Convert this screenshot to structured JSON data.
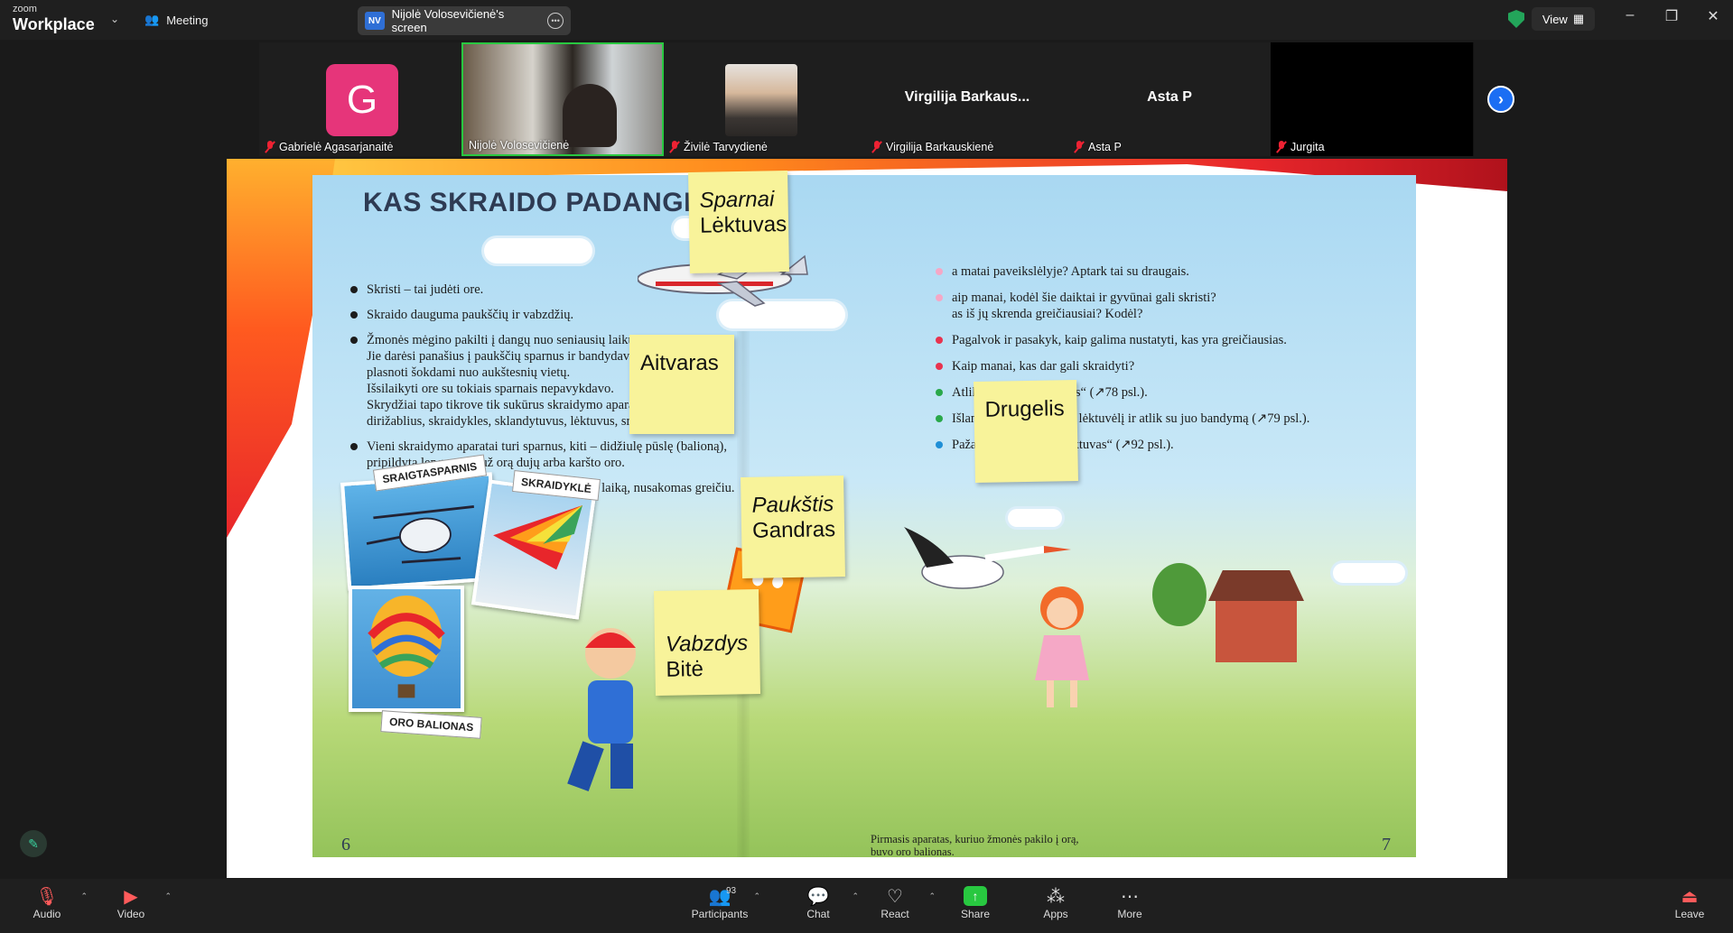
{
  "app": {
    "brand_top": "zoom",
    "brand_bottom": "Workplace"
  },
  "header": {
    "meeting_label": "Meeting",
    "share_pill": {
      "badge": "NV",
      "label": "Nijolė Volosevičienė's screen"
    },
    "view_label": "View"
  },
  "participants": [
    {
      "name": "Gabrielė Agasarjanaitė",
      "avatar_letter": "G",
      "avatar_color": "#e6357a",
      "muted": true
    },
    {
      "name": "Nijolė Volosevičienė",
      "active": true,
      "muted": false
    },
    {
      "name": "Živilė Tarvydienė",
      "muted": true
    },
    {
      "name": "Virgilija Barkauskienė",
      "display_name": "Virgilija  Barkaus...",
      "muted": true
    },
    {
      "name": "Asta P",
      "display_name": "Asta P",
      "muted": true
    },
    {
      "name": "Jurgita",
      "muted": true
    }
  ],
  "slide": {
    "title": "KAS SKRAIDO PADANGĖJE?",
    "left_bullets": [
      "Skristi – tai judėti ore.",
      "Skraido dauguma paukščių ir vabzdžių.",
      "Žmonės mėgino pakilti į dangų nuo seniausių laikų.\nJie darėsi panašius į paukščių sparnus ir bandydavo jais\nplasnoti šokdami nuo aukštesnių vietų.\nIšsilaikyti ore su tokiais sparnais nepavykdavo.\nSkrydžiai tapo tikrove tik sukūrus skraidymo aparatus – oro balionus,\ndirižablius, skraidykles, sklandytuvus, lėktuvus, sraigtasparnius.",
      "Vieni skraidymo aparatai turi sparnus, kiti – didžiulę pūslę (balioną),\npripildytą lengvesnių už orą dujų arba karšto oro.",
      "Atstumas, kuris nukeliaujamas per nustatytą laiką, nusakomas greičiu."
    ],
    "right_bullets": [
      {
        "text": "a matai paveikslėlyje? Aptark tai su draugais.",
        "color": "#f5a8c6"
      },
      {
        "text": "aip manai, kodėl šie daiktai ir gyvūnai gali skristi?\nas iš jų skrenda greičiausiai? Kodėl?",
        "color": "#f5a8c6"
      },
      {
        "text": "Pagalvok ir pasakyk, kaip galima nustatyti, kas yra greičiausias.",
        "color": "#e8334f"
      },
      {
        "text": "Kaip manai, kas dar gali skraidyti?",
        "color": "#e8334f"
      },
      {
        "text": "Atlik bandymą „Sparnas“ (↗78 psl.).",
        "color": "#2aa84a"
      },
      {
        "text": "Išlankstyk iš popieriaus lėktuvėlį ir atlik su juo bandymą (↗79 psl.).",
        "color": "#2aa84a"
      },
      {
        "text": "Pažaiskite žaidimą „Lėktuvas“ (↗92 psl.).",
        "color": "#1f8fd6"
      }
    ],
    "tags": {
      "helicopter": "SRAIGTASPARNIS",
      "glider": "SKRAIDYKLĖ",
      "balloon": "ORO BALIONAS"
    },
    "caption": "Pirmasis aparatas, kuriuo žmonės pakilo į orą,\nbuvo oro balionas.",
    "page_left": "6",
    "page_right": "7",
    "stickies": {
      "s1_line1": "Sparnai",
      "s1_line2": "Lėktuvas",
      "s2": "Aitvaras",
      "s3": "Drugelis",
      "s4_line1": "Paukštis",
      "s4_line2": "Gandras",
      "s5_line1": "Vabzdys",
      "s5_line2": "Bitė"
    }
  },
  "toolbar": {
    "audio": "Audio",
    "video": "Video",
    "participants": "Participants",
    "participants_count": "93",
    "chat": "Chat",
    "react": "React",
    "share": "Share",
    "apps": "Apps",
    "more": "More",
    "leave": "Leave"
  },
  "colors": {
    "share_green": "#28c840",
    "accent_blue": "#1b6ef3",
    "sticky_yellow": "#f8f39a"
  }
}
